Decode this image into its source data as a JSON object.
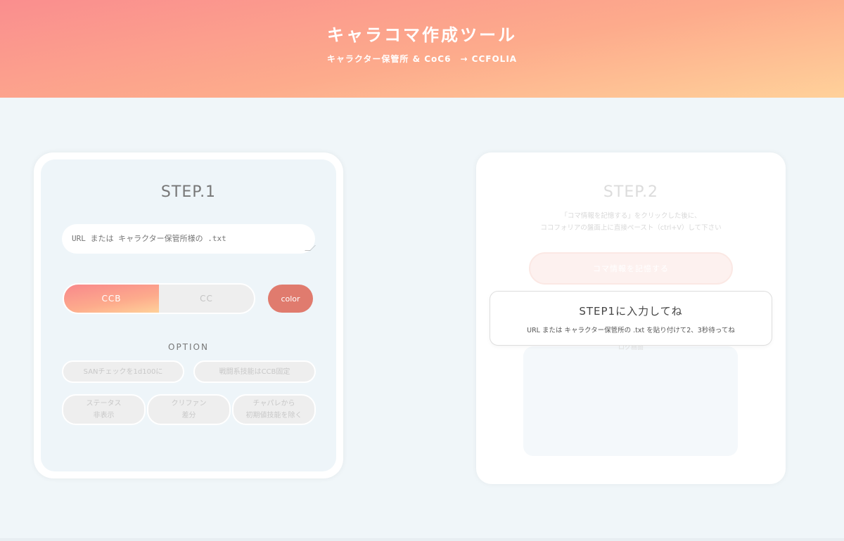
{
  "header": {
    "title": "キャラコマ作成ツール",
    "subtitle": "キャラクター保管所 & CoC6　→ CCFOLIA"
  },
  "step1": {
    "title": "STEP.1",
    "input": {
      "placeholder": "URL または キャラクター保管所様の .txt",
      "value": ""
    },
    "mode_toggle": {
      "options": [
        "CCB",
        "CC"
      ],
      "selected": "CCB"
    },
    "color_label": "color",
    "option_title": "OPTION",
    "options": {
      "san_check": "SANチェックを1d100に",
      "battle_ccb": "戦闘系技能はCCB固定",
      "status_hide_1": "ステータス",
      "status_hide_2": "非表示",
      "clip_diff_1": "クリファン",
      "clip_diff_2": "差分",
      "chapare_1": "チャパレから",
      "chapare_2": "初期値技能を除く"
    }
  },
  "step2": {
    "title": "STEP.2",
    "desc_line1": "「コマ情報を記憶する」をクリックした後に、",
    "desc_line2": "ココフォリアの盤面上に直接ペースト（ctrl+V）して下さい",
    "copy_button": "コマ情報を記憶する",
    "preview_label": "ログ画面"
  },
  "toast": {
    "title": "STEP1に入力してね",
    "message": "URL または キャラクター保管所の .txt を貼り付けて2、3秒待ってね"
  },
  "colors": {
    "accent_gradient_start": "#fa8e8e",
    "accent_gradient_end": "#ffd19a",
    "color_button": "#e07b6e",
    "background": "#f0f6f9"
  }
}
